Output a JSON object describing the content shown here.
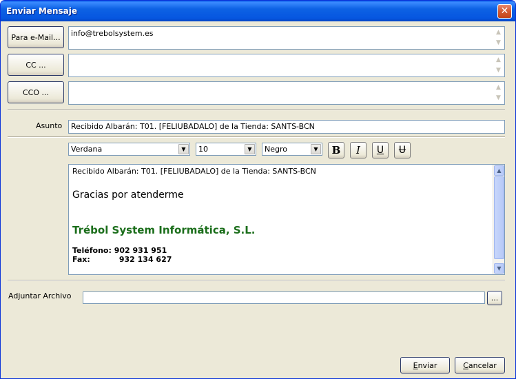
{
  "window": {
    "title": "Enviar Mensaje",
    "close_glyph": "✕"
  },
  "recipients": {
    "to_button": "Para e-Mail...",
    "to_value": "info@trebolsystem.es",
    "cc_button": "CC ...",
    "cc_value": "",
    "bcc_button": "CCO ...",
    "bcc_value": ""
  },
  "subject": {
    "label": "Asunto",
    "value": "Recibido Albarán: T01. [FELIUBADALO] de la Tienda: SANTS-BCN"
  },
  "format_toolbar": {
    "font": "Verdana",
    "size": "10",
    "color": "Negro",
    "bold": "B",
    "italic": "I",
    "underline": "U",
    "strike": "U"
  },
  "body": {
    "line1": "Recibido Albarán: T01. [FELIUBADALO] de la Tienda: SANTS-BCN",
    "line2": "Gracias por atenderme",
    "company": "Trébol System Informática, S.L.",
    "phone_label": "Teléfono:",
    "phone_value": "902 931 951",
    "fax_label": "Fax:",
    "fax_value": "932 134 627",
    "company_color": "#1b6e1b"
  },
  "attachment": {
    "label": "Adjuntar Archivo",
    "value": "",
    "browse": "..."
  },
  "footer": {
    "send_accel": "E",
    "send_rest": "nviar",
    "cancel_accel": "C",
    "cancel_rest": "ancelar"
  }
}
